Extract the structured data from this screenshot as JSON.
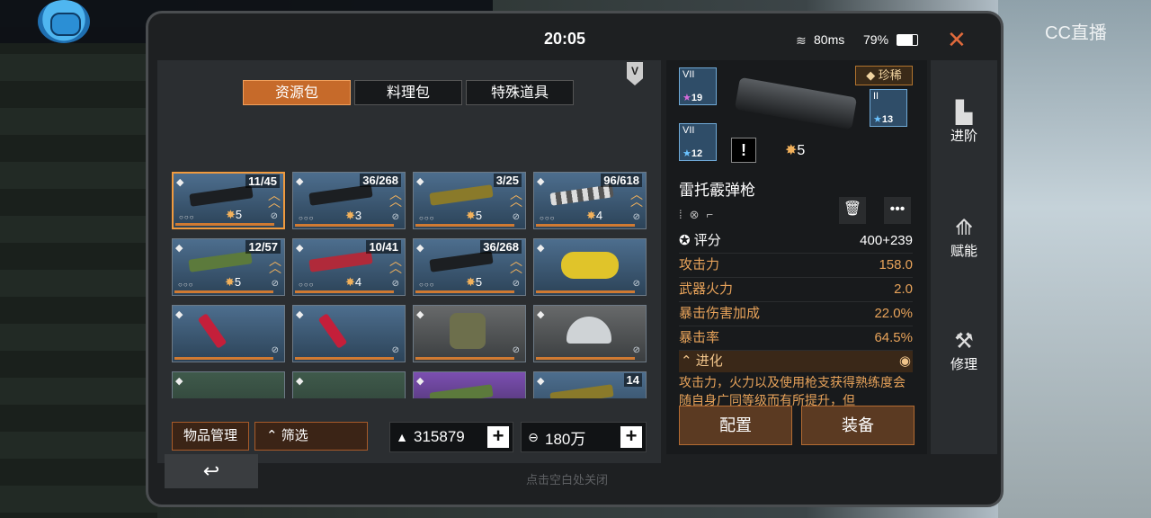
{
  "overlay": {
    "watermark": "CC直播",
    "menu_arrow": "▼"
  },
  "status": {
    "time": "20:05",
    "ping": "80ms",
    "battery": "79%",
    "battery_level": 0.79,
    "close": "✕"
  },
  "tabs": [
    "资源包",
    "料理包",
    "特殊道具"
  ],
  "tier_badge": "V",
  "grid": [
    {
      "count": "11/45",
      "stars": "5",
      "type": "gun",
      "selected": true
    },
    {
      "count": "36/268",
      "stars": "3",
      "type": "gun"
    },
    {
      "count": "3/25",
      "stars": "5",
      "type": "gun-gold"
    },
    {
      "count": "96/618",
      "stars": "4",
      "type": "gun-camo"
    },
    {
      "count": "12/57",
      "stars": "5",
      "type": "gun-green"
    },
    {
      "count": "10/41",
      "stars": "4",
      "type": "gun-red"
    },
    {
      "count": "36/268",
      "stars": "5",
      "type": "gun"
    },
    {
      "count": "",
      "stars": "",
      "type": "saw"
    },
    {
      "count": "",
      "stars": "",
      "type": "axe"
    },
    {
      "count": "",
      "stars": "",
      "type": "axe"
    },
    {
      "count": "",
      "stars": "",
      "type": "vest"
    },
    {
      "count": "",
      "stars": "",
      "type": "helmet"
    },
    {
      "count": "",
      "stars": "",
      "type": "box"
    },
    {
      "count": "",
      "stars": "",
      "type": "bottle"
    },
    {
      "count": "",
      "stars": "",
      "type": "gun-purple"
    },
    {
      "count": "14",
      "stars": "",
      "type": "gun-gold"
    }
  ],
  "bottom": {
    "manage": "物品管理",
    "filter": "筛选",
    "currency1": "315879",
    "currency2": "180万",
    "plus": "+",
    "back": "↩",
    "hint": "点击空白处关闭"
  },
  "detail": {
    "levels": [
      {
        "tier": "VII",
        "num": "19",
        "star_color": "purple"
      },
      {
        "tier": "VII",
        "num": "12",
        "star_color": "blue"
      },
      {
        "tier": "II",
        "num": "13",
        "star_color": "blue"
      }
    ],
    "rarity": "珍稀",
    "alert": "!",
    "stars": "5",
    "name": "雷托霰弹枪",
    "score_label": "评分",
    "score_value": "400+239",
    "stats": [
      {
        "k": "攻击力",
        "v": "158.0"
      },
      {
        "k": "武器火力",
        "v": "2.0"
      },
      {
        "k": "暴击伤害加成",
        "v": "22.0%"
      },
      {
        "k": "暴击率",
        "v": "64.5%"
      }
    ],
    "evolution": "进化",
    "description": "攻击力，火力以及使用枪支获得熟练度会随自身广同等级而有所提升，但",
    "btn_config": "配置",
    "btn_equip": "装备"
  },
  "side": [
    "进阶",
    "赋能",
    "修理"
  ]
}
